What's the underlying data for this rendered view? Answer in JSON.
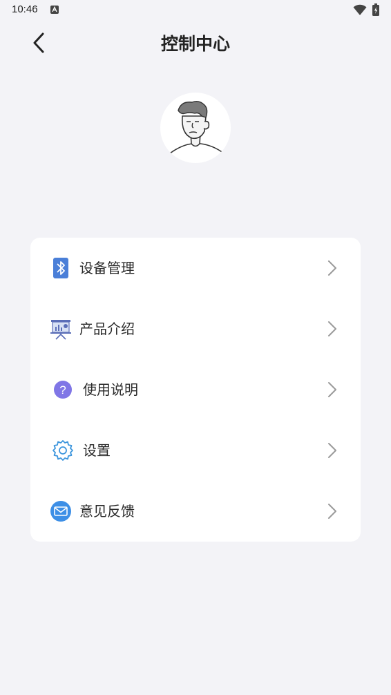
{
  "status_bar": {
    "time": "10:46"
  },
  "header": {
    "title": "控制中心"
  },
  "menu": {
    "items": [
      {
        "label": "设备管理",
        "icon": "bluetooth-icon"
      },
      {
        "label": "产品介绍",
        "icon": "presentation-icon"
      },
      {
        "label": "使用说明",
        "icon": "help-icon"
      },
      {
        "label": "设置",
        "icon": "gear-icon"
      },
      {
        "label": "意见反馈",
        "icon": "mail-icon"
      }
    ]
  },
  "colors": {
    "background": "#f3f3f7",
    "card": "#ffffff",
    "bluetooth": "#4a7fd8",
    "help": "#8076e6",
    "gear": "#3c95dd",
    "mail": "#3d8fe6",
    "chevron": "#9a9a9a"
  }
}
